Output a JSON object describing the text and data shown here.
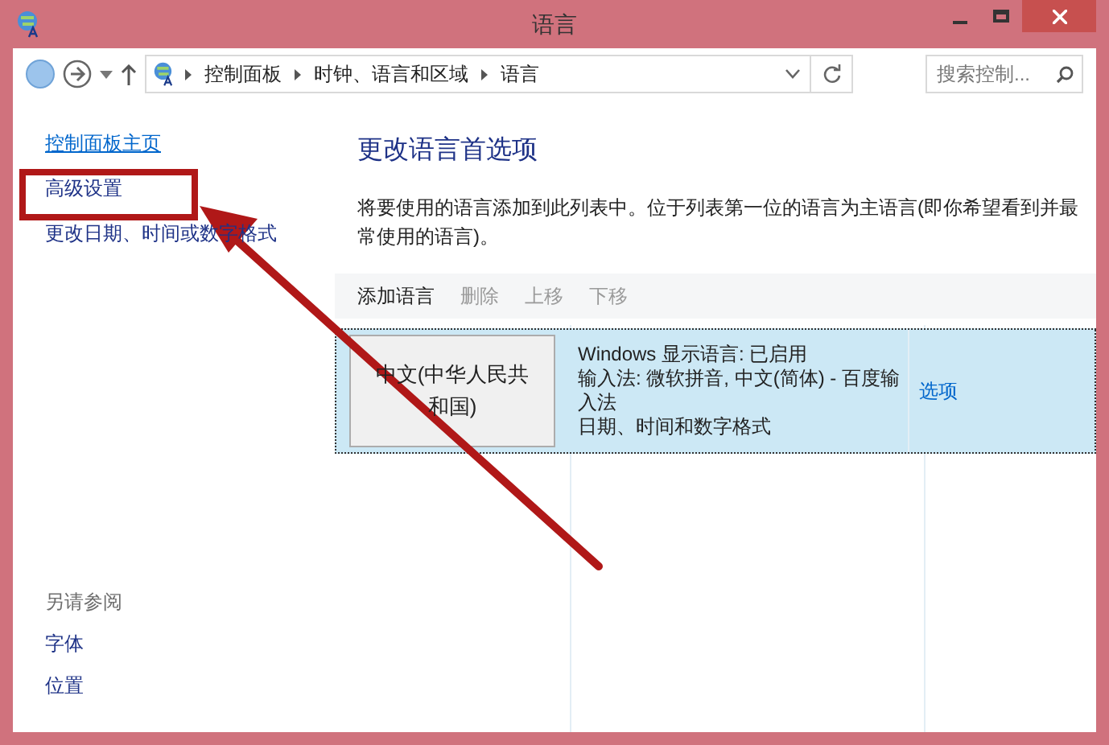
{
  "window": {
    "title": "语言"
  },
  "address": {
    "crumbs": [
      "控制面板",
      "时钟、语言和区域",
      "语言"
    ]
  },
  "search": {
    "placeholder": "搜索控制..."
  },
  "sidebar": {
    "items": [
      {
        "label": "控制面板主页",
        "kind": "home"
      },
      {
        "label": "高级设置",
        "kind": "link"
      },
      {
        "label": "更改日期、时间或数字格式",
        "kind": "link"
      }
    ],
    "see_also": {
      "heading": "另请参阅",
      "items": [
        "字体",
        "位置"
      ]
    }
  },
  "main": {
    "heading": "更改语言首选项",
    "description": "将要使用的语言添加到此列表中。位于列表第一位的语言为主语言(即你希望看到并最常使用的语言)。",
    "toolbar": [
      {
        "label": "添加语言",
        "disabled": false
      },
      {
        "label": "删除",
        "disabled": true
      },
      {
        "label": "上移",
        "disabled": true
      },
      {
        "label": "下移",
        "disabled": true
      }
    ],
    "languages": [
      {
        "name": "中文(中华人民共和国)",
        "details": [
          "Windows 显示语言: 已启用",
          "输入法: 微软拼音, 中文(简体) - 百度输入法",
          "日期、时间和数字格式"
        ],
        "options": "选项",
        "selected": true
      }
    ]
  }
}
